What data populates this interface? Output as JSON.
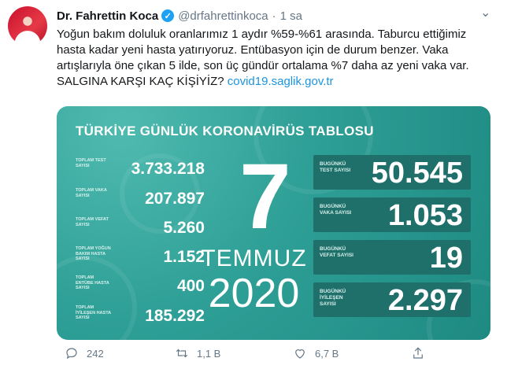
{
  "tweet": {
    "author_name": "Dr. Fahrettin Koca",
    "handle": "@drfahrettinkoca",
    "separator": "·",
    "time": "1 sa",
    "text": "Yoğun bakım doluluk oranlarımız 1 aydır %59-%61 arasında. Taburcu ettiğimiz hasta kadar yeni hasta yatırıyoruz. Entübasyon için de durum benzer. Vaka artışlarıyla öne çıkan 5 ilde, son üç gündür ortalama %7 daha az yeni vaka var. SALGINA KARŞI KAÇ KİŞİYİZ?",
    "link": "covid19.saglik.gov.tr"
  },
  "card": {
    "title": "TÜRKİYE GÜNLÜK KORONAVİRÜS TABLOSU",
    "totals": [
      {
        "label": "TOPLAM TEST SAYISI",
        "value": "3.733.218"
      },
      {
        "label": "TOPLAM VAKA SAYISI",
        "value": "207.897"
      },
      {
        "label": "TOPLAM VEFAT SAYISI",
        "value": "5.260"
      },
      {
        "label": "TOPLAM YOĞUN BAKIM HASTA SAYISI",
        "value": "1.152"
      },
      {
        "label": "TOPLAM ENTÜBE HASTA SAYISI",
        "value": "400"
      },
      {
        "label": "TOPLAM İYİLEŞEN HASTA SAYISI",
        "value": "185.292"
      }
    ],
    "day": "7",
    "month": "TEMMUZ",
    "year": "2020",
    "daily": [
      {
        "label": "BUGÜNKÜ TEST SAYISI",
        "value": "50.545"
      },
      {
        "label": "BUGÜNKÜ VAKA SAYISI",
        "value": "1.053"
      },
      {
        "label": "BUGÜNKÜ VEFAT SAYISI",
        "value": "19"
      },
      {
        "label": "BUGÜNKÜ İYİLEŞEN SAYISI",
        "value": "2.297"
      }
    ]
  },
  "actions": {
    "reply_count": "242",
    "retweet_count": "1,1 B",
    "like_count": "6,7 B"
  },
  "icons": {
    "verified": "verified-badge-icon",
    "more": "more-icon",
    "reply": "reply-icon",
    "retweet": "retweet-icon",
    "like": "heart-icon",
    "share": "share-icon"
  },
  "colors": {
    "link": "#1b95e0",
    "verified": "#1da1f2",
    "card_bg": "#2e9f96",
    "card_box": "#1f6f6a"
  }
}
